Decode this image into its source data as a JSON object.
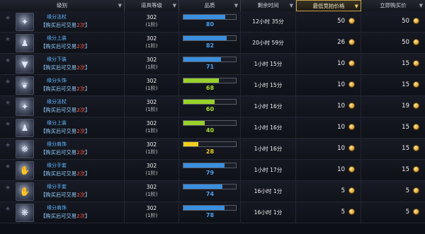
{
  "header": {
    "col_item": "级别",
    "col_level": "道具等级",
    "col_quality": "品质",
    "col_time": "剩余时间",
    "col_min_bid": "最低竞拍价格",
    "col_buyout": "立即购买价",
    "sort_arrow": "▼"
  },
  "colors": {
    "blue_bar": "#3a8fe0",
    "green_bar": "#9ad12a",
    "yellow_bar": "#f2cf1c"
  },
  "rows": [
    {
      "name": "缘分法杖",
      "note_pre": "【购买后可交易",
      "note_hl": "2次",
      "note_post": "】",
      "level": "302",
      "grade": "(1阶)",
      "quality": "80",
      "quality_pct": 80,
      "quality_color": "blue",
      "time": "12小时 35分",
      "min_bid": "50",
      "buyout": "50",
      "icon": "staff-icon",
      "glyph": "✦"
    },
    {
      "name": "缘分上装",
      "note_pre": "【购买后可交易",
      "note_hl": "2次",
      "note_post": "】",
      "level": "302",
      "grade": "(1阶)",
      "quality": "82",
      "quality_pct": 82,
      "quality_color": "blue",
      "time": "20小时 59分",
      "min_bid": "26",
      "buyout": "50",
      "icon": "upper-garment-icon",
      "glyph": "♟"
    },
    {
      "name": "缘分下装",
      "note_pre": "【购买后可交易",
      "note_hl": "2次",
      "note_post": "】",
      "level": "302",
      "grade": "(1阶)",
      "quality": "71",
      "quality_pct": 71,
      "quality_color": "blue",
      "time": "1小时 15分",
      "min_bid": "10",
      "buyout": "15",
      "icon": "lower-garment-icon",
      "glyph": "▼"
    },
    {
      "name": "缘分头饰",
      "note_pre": "【购买后可交易",
      "note_hl": "2次",
      "note_post": "】",
      "level": "302",
      "grade": "(1阶)",
      "quality": "68",
      "quality_pct": 68,
      "quality_color": "green",
      "time": "1小时 15分",
      "min_bid": "10",
      "buyout": "15",
      "icon": "headwear-icon",
      "glyph": "❦"
    },
    {
      "name": "缘分法杖",
      "note_pre": "【购买后可交易",
      "note_hl": "2次",
      "note_post": "】",
      "level": "302",
      "grade": "(1阶)",
      "quality": "60",
      "quality_pct": 60,
      "quality_color": "green",
      "time": "1小时 16分",
      "min_bid": "10",
      "buyout": "19",
      "icon": "staff-icon",
      "glyph": "✦"
    },
    {
      "name": "缘分上装",
      "note_pre": "【购买后可交易",
      "note_hl": "2次",
      "note_post": "】",
      "level": "302",
      "grade": "(1阶)",
      "quality": "40",
      "quality_pct": 40,
      "quality_color": "green",
      "time": "1小时 16分",
      "min_bid": "10",
      "buyout": "15",
      "icon": "upper-garment-icon",
      "glyph": "♟"
    },
    {
      "name": "缘分肩饰",
      "note_pre": "【购买后可交易",
      "note_hl": "2次",
      "note_post": "】",
      "level": "302",
      "grade": "(1阶)",
      "quality": "28",
      "quality_pct": 28,
      "quality_color": "yellow",
      "time": "1小时 16分",
      "min_bid": "10",
      "buyout": "15",
      "icon": "shoulder-icon",
      "glyph": "❋"
    },
    {
      "name": "缘分手套",
      "note_pre": "【购买后可交易",
      "note_hl": "2次",
      "note_post": "】",
      "level": "302",
      "grade": "(1阶)",
      "quality": "79",
      "quality_pct": 79,
      "quality_color": "blue",
      "time": "1小时 17分",
      "min_bid": "10",
      "buyout": "15",
      "icon": "glove-icon",
      "glyph": "✋"
    },
    {
      "name": "缘分手套",
      "note_pre": "【购买后可交易",
      "note_hl": "2次",
      "note_post": "】",
      "level": "302",
      "grade": "(1阶)",
      "quality": "74",
      "quality_pct": 74,
      "quality_color": "blue",
      "time": "16小时 1分",
      "min_bid": "5",
      "buyout": "5",
      "icon": "glove-icon",
      "glyph": "✋"
    },
    {
      "name": "缘分肩饰",
      "note_pre": "【购买后可交易",
      "note_hl": "2次",
      "note_post": "】",
      "level": "302",
      "grade": "(1阶)",
      "quality": "78",
      "quality_pct": 78,
      "quality_color": "blue",
      "time": "16小时 1分",
      "min_bid": "5",
      "buyout": "5",
      "icon": "shoulder-icon",
      "glyph": "❋"
    }
  ]
}
